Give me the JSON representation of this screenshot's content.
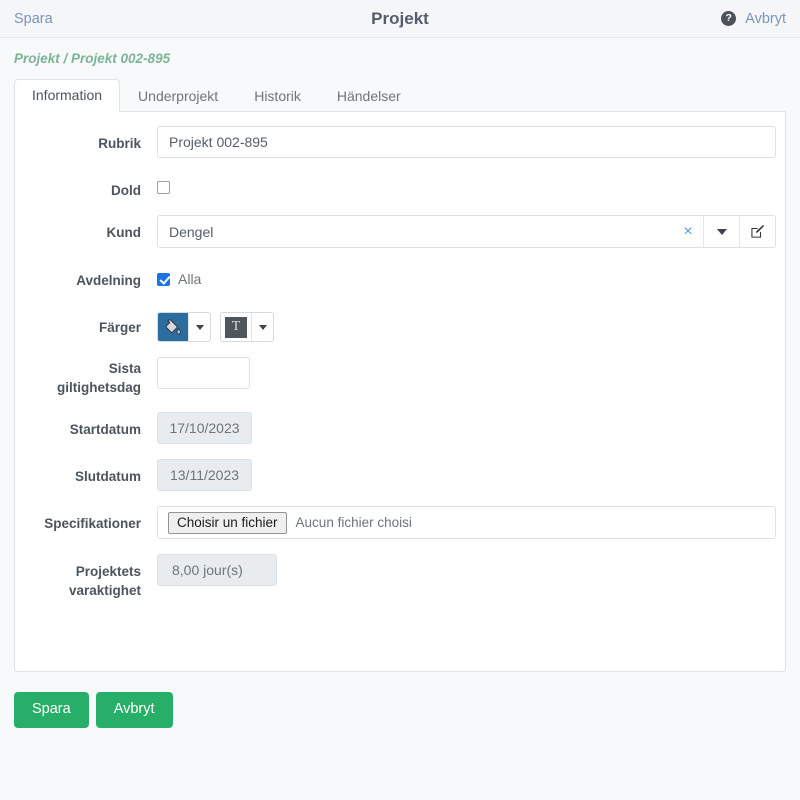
{
  "topbar": {
    "save_label": "Spara",
    "title": "Projekt",
    "help_glyph": "?",
    "cancel_label": "Avbryt"
  },
  "breadcrumb": "Projekt / Projekt 002-895",
  "tabs": [
    {
      "label": "Information",
      "active": true
    },
    {
      "label": "Underprojekt",
      "active": false
    },
    {
      "label": "Historik",
      "active": false
    },
    {
      "label": "Händelser",
      "active": false
    }
  ],
  "form": {
    "rubrik": {
      "label": "Rubrik",
      "value": "Projekt 002-895"
    },
    "dold": {
      "label": "Dold",
      "checked": false
    },
    "kund": {
      "label": "Kund",
      "value": "Dengel",
      "clear_glyph": "×",
      "edit_glyph": "✎"
    },
    "avdelning": {
      "label": "Avdelning",
      "option": "Alla",
      "checked": true
    },
    "farger": {
      "label": "Färger",
      "fill_color": "#2a6d9e",
      "text_color": "#4e555b",
      "text_glyph": "T"
    },
    "sista_giltighetsdag": {
      "label": "Sista giltighetsdag",
      "value": ""
    },
    "startdatum": {
      "label": "Startdatum",
      "value": "17/10/2023"
    },
    "slutdatum": {
      "label": "Slutdatum",
      "value": "13/11/2023"
    },
    "specifikationer": {
      "label": "Specifikationer",
      "button_label": "Choisir un fichier",
      "status": "Aucun fichier choisi"
    },
    "varaktighet": {
      "label": "Projektets varaktighet",
      "value": "8,00 jour(s)"
    }
  },
  "footer": {
    "save_label": "Spara",
    "cancel_label": "Avbryt",
    "accent": "#27ae68"
  }
}
